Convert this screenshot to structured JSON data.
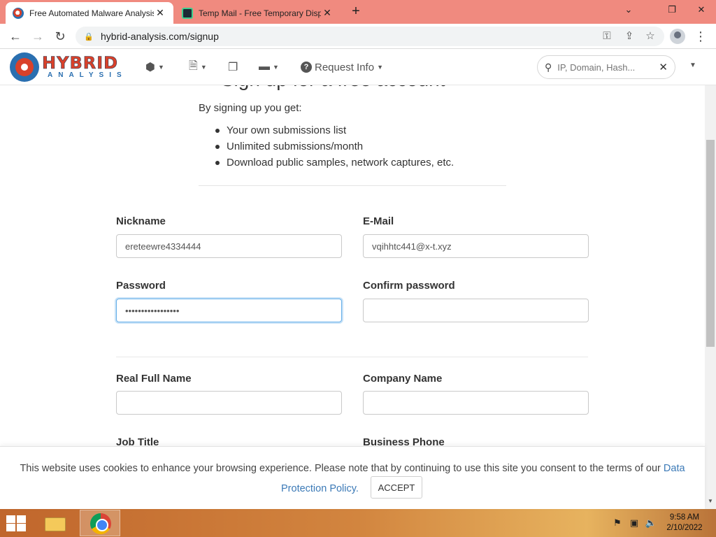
{
  "browser": {
    "tabs": [
      {
        "title": "Free Automated Malware Analysis",
        "close": "✕"
      },
      {
        "title": "Temp Mail - Free Temporary Disposable",
        "close": "✕"
      }
    ],
    "new_tab": "+",
    "window_controls": {
      "minimize": "⌄",
      "restore": "❐",
      "close": "✕"
    },
    "address": {
      "url": "hybrid-analysis.com/signup"
    }
  },
  "site": {
    "logo": {
      "word": "HYBRID",
      "sub": "ANALYSIS"
    },
    "nav": {
      "request_info": "Request Info"
    },
    "search": {
      "placeholder": "IP, Domain, Hash..."
    }
  },
  "signup": {
    "heading": "Sign up for a free account",
    "intro": "By signing up you get:",
    "benefits": [
      "Your own submissions list",
      "Unlimited submissions/month",
      "Download public samples, network captures, etc."
    ],
    "fields": {
      "nickname": {
        "label": "Nickname",
        "value": "ereteewre4334444"
      },
      "email": {
        "label": "E-Mail",
        "value": "vqihhtc441@x-t.xyz"
      },
      "password": {
        "label": "Password",
        "value": "•••••••••••••••••"
      },
      "confirm_password": {
        "label": "Confirm password",
        "value": ""
      },
      "real_full_name": {
        "label": "Real Full Name",
        "value": ""
      },
      "company_name": {
        "label": "Company Name",
        "value": ""
      },
      "job_title": {
        "label": "Job Title"
      },
      "business_phone": {
        "label": "Business Phone"
      }
    }
  },
  "cookie_banner": {
    "text": "This website uses cookies to enhance your browsing experience. Please note that by continuing to use this site you consent to the terms of our",
    "link_part1": "Data",
    "link_part2": "Protection Policy.",
    "accept_label": "ACCEPT"
  },
  "taskbar": {
    "time": "9:58 AM",
    "date": "2/10/2022"
  },
  "colors": {
    "tab_strip": "#f08a7f",
    "logo_red": "#d9412a",
    "logo_blue": "#2a6fb0",
    "link_blue": "#3c7ab7",
    "focus_blue": "#66afe9"
  }
}
